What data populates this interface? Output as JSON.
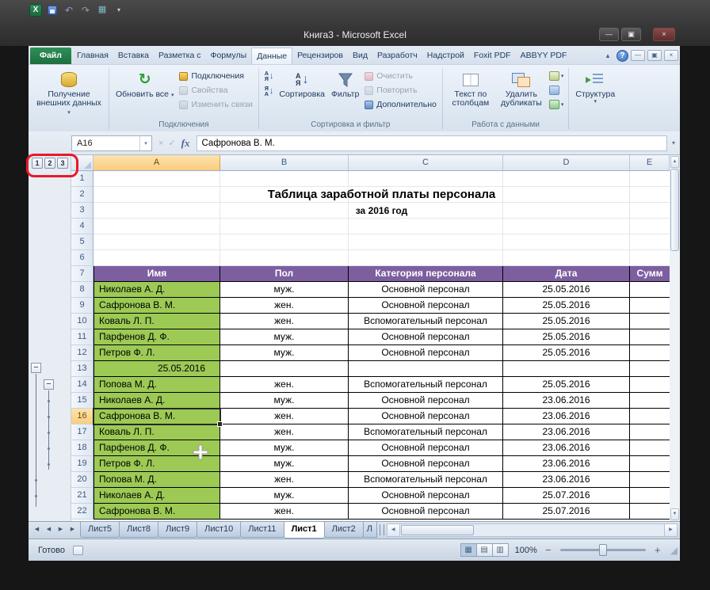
{
  "window": {
    "title": "Книга3 - Microsoft Excel"
  },
  "ribbon": {
    "tabs": [
      "Файл",
      "Главная",
      "Вставка",
      "Разметка с",
      "Формулы",
      "Данные",
      "Рецензиров",
      "Вид",
      "Разработч",
      "Надстрой",
      "Foxit PDF",
      "ABBYY PDF"
    ],
    "active_tab": "Данные",
    "file_tab": "Файл",
    "get_external": "Получение внешних данных",
    "refresh_all": "Обновить все",
    "connections": "Подключения",
    "properties": "Свойства",
    "edit_links": "Изменить связи",
    "connections_group": "Подключения",
    "sort": "Сортировка",
    "filter": "Фильтр",
    "clear": "Очистить",
    "reapply": "Повторить",
    "advanced": "Дополнительно",
    "sort_group": "Сортировка и фильтр",
    "text_to_columns": "Текст по столбцам",
    "remove_duplicates": "Удалить дубликаты",
    "data_group": "Работа с данными",
    "outline_button": "Структура"
  },
  "formula_bar": {
    "name_box": "A16",
    "fx": "fx",
    "value": "Сафронова В. М."
  },
  "outline": {
    "levels": [
      "1",
      "2",
      "3"
    ]
  },
  "grid": {
    "col_headers": [
      "A",
      "B",
      "C",
      "D",
      "E"
    ],
    "title_line1": "Таблица заработной платы персонала",
    "title_line2": "за 2016 год",
    "table_header": [
      "Имя",
      "Пол",
      "Категория персонала",
      "Дата",
      "Сумм"
    ],
    "rows": [
      {
        "n": 1
      },
      {
        "n": 2
      },
      {
        "n": 3
      },
      {
        "n": 4
      },
      {
        "n": 5
      },
      {
        "n": 6
      },
      {
        "n": 7,
        "header": true
      },
      {
        "n": 8,
        "a": "Николаев А. Д.",
        "b": "муж.",
        "c": "Основной персонал",
        "d": "25.05.2016"
      },
      {
        "n": 9,
        "a": "Сафронова В. М.",
        "b": "жен.",
        "c": "Основной персонал",
        "d": "25.05.2016"
      },
      {
        "n": 10,
        "a": "Коваль Л. П.",
        "b": "жен.",
        "c": "Вспомогательный персонал",
        "d": "25.05.2016"
      },
      {
        "n": 11,
        "a": "Парфенов Д. Ф.",
        "b": "муж.",
        "c": "Основной персонал",
        "d": "25.05.2016"
      },
      {
        "n": 12,
        "a": "Петров Ф. Л.",
        "b": "муж.",
        "c": "Основной персонал",
        "d": "25.05.2016"
      },
      {
        "n": 13,
        "a": "25.05.2016",
        "b": "",
        "c": "",
        "d": "",
        "group_row": true
      },
      {
        "n": 14,
        "a": "Попова М. Д.",
        "b": "жен.",
        "c": "Вспомогательный персонал",
        "d": "25.05.2016"
      },
      {
        "n": 15,
        "a": "Николаев А. Д.",
        "b": "муж.",
        "c": "Основной персонал",
        "d": "23.06.2016"
      },
      {
        "n": 16,
        "a": "Сафронова В. М.",
        "b": "жен.",
        "c": "Основной персонал",
        "d": "23.06.2016",
        "selected": true
      },
      {
        "n": 17,
        "a": "Коваль Л. П.",
        "b": "жен.",
        "c": "Вспомогательный персонал",
        "d": "23.06.2016"
      },
      {
        "n": 18,
        "a": "Парфенов Д. Ф.",
        "b": "муж.",
        "c": "Основной персонал",
        "d": "23.06.2016"
      },
      {
        "n": 19,
        "a": "Петров Ф. Л.",
        "b": "муж.",
        "c": "Основной персонал",
        "d": "23.06.2016"
      },
      {
        "n": 20,
        "a": "Попова М. Д.",
        "b": "жен.",
        "c": "Вспомогательный персонал",
        "d": "23.06.2016"
      },
      {
        "n": 21,
        "a": "Николаев А. Д.",
        "b": "муж.",
        "c": "Основной персонал",
        "d": "25.07.2016"
      },
      {
        "n": 22,
        "a": "Сафронова В. М.",
        "b": "жен.",
        "c": "Основной персонал",
        "d": "25.07.2016"
      }
    ]
  },
  "sheets": {
    "tabs": [
      "Лист5",
      "Лист8",
      "Лист9",
      "Лист10",
      "Лист11",
      "Лист1",
      "Лист2",
      "Л"
    ],
    "active": "Лист1"
  },
  "status": {
    "ready": "Готово",
    "zoom": "100%"
  },
  "colors": {
    "table_header_fill": "#7d5fa0",
    "name_column_fill": "#9cca55",
    "annotation_red": "#e8192c"
  }
}
